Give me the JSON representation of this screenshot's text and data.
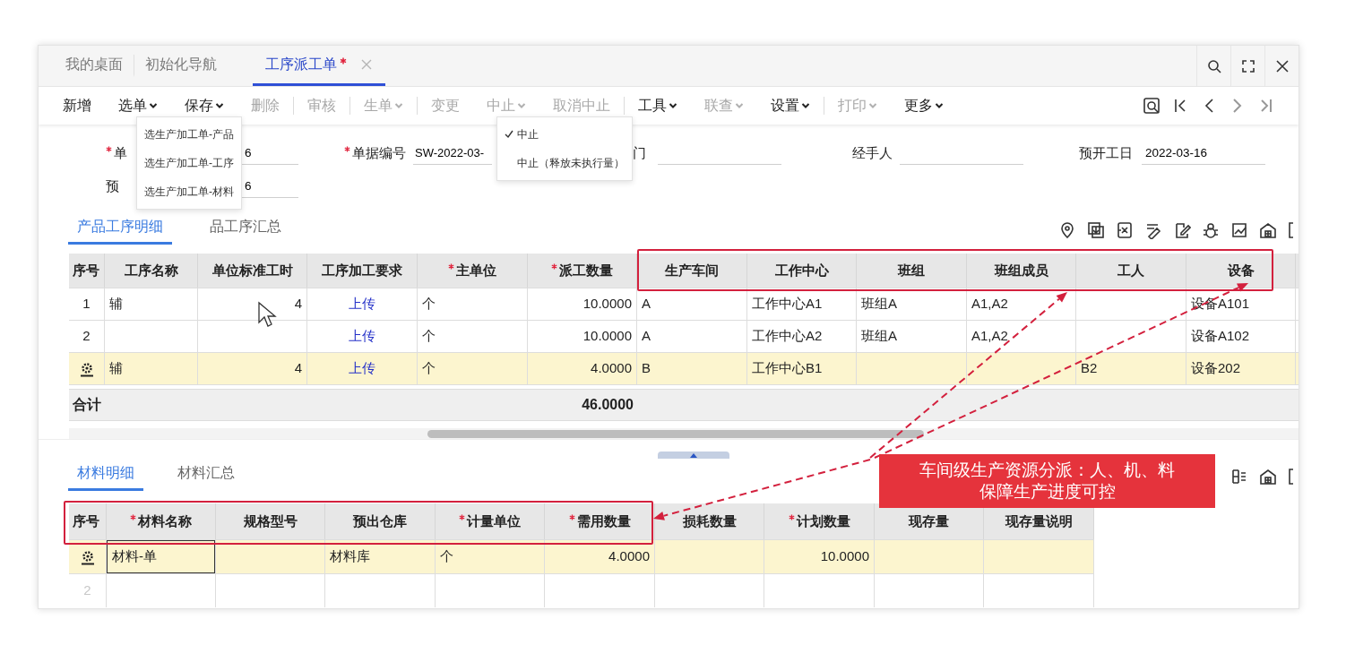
{
  "tabs": [
    {
      "label": "我的桌面",
      "selected": false,
      "modified": false,
      "closable": false
    },
    {
      "label": "初始化导航",
      "selected": false,
      "modified": false,
      "closable": false
    },
    {
      "label": "工序派工单",
      "selected": true,
      "modified": true,
      "closable": true
    }
  ],
  "toolbar": {
    "items": [
      {
        "label": "新增",
        "disabled": false,
        "dropdown": false,
        "separator_before": false
      },
      {
        "label": "选单",
        "disabled": false,
        "dropdown": true,
        "separator_before": false,
        "menu": {
          "items": [
            {
              "label": "选生产加工单-产品",
              "checked": false
            },
            {
              "label": "选生产加工单-工序",
              "checked": false
            },
            {
              "label": "选生产加工单-材料",
              "checked": false
            }
          ]
        }
      },
      {
        "label": "保存",
        "disabled": false,
        "dropdown": true,
        "separator_before": false
      },
      {
        "label": "删除",
        "disabled": true,
        "dropdown": false,
        "separator_before": false
      },
      {
        "label": "审核",
        "disabled": true,
        "dropdown": false,
        "separator_before": true
      },
      {
        "label": "生单",
        "disabled": true,
        "dropdown": true,
        "separator_before": true
      },
      {
        "label": "变更",
        "disabled": true,
        "dropdown": false,
        "separator_before": true
      },
      {
        "label": "中止",
        "disabled": true,
        "dropdown": true,
        "separator_before": false,
        "menu": {
          "items": [
            {
              "label": "中止",
              "checked": true
            },
            {
              "label": "中止（释放未执行量）",
              "checked": false
            }
          ]
        }
      },
      {
        "label": "取消中止",
        "disabled": true,
        "dropdown": false,
        "separator_before": false
      },
      {
        "label": "工具",
        "disabled": false,
        "dropdown": true,
        "separator_before": true
      },
      {
        "label": "联查",
        "disabled": true,
        "dropdown": true,
        "separator_before": false
      },
      {
        "label": "设置",
        "disabled": false,
        "dropdown": true,
        "separator_before": false
      },
      {
        "label": "打印",
        "disabled": true,
        "dropdown": true,
        "separator_before": true
      },
      {
        "label": "更多",
        "disabled": false,
        "dropdown": true,
        "separator_before": false
      }
    ]
  },
  "form": {
    "rows": [
      [
        {
          "label": "单",
          "required": true,
          "value": "6"
        },
        {
          "label": "单据编号",
          "required": true,
          "value": "SW-2022-03-"
        },
        {
          "label": "门",
          "required": false
        },
        {
          "label": "经手人",
          "required": false
        },
        {
          "label": "预开工日",
          "required": false,
          "value": "2022-03-16"
        }
      ],
      [
        {
          "label": "预",
          "required": false,
          "value": "6"
        }
      ]
    ]
  },
  "detail_tabs": [
    {
      "label": "产品工序明细",
      "selected": true
    },
    {
      "label": "品工序汇总",
      "selected": false
    }
  ],
  "process_table": {
    "columns": [
      {
        "label": "序号",
        "required": false,
        "kind": "seq"
      },
      {
        "label": "工序名称",
        "required": false,
        "kind": "text"
      },
      {
        "label": "单位标准工时",
        "required": false,
        "kind": "number"
      },
      {
        "label": "工序加工要求",
        "required": false,
        "kind": "link"
      },
      {
        "label": "主单位",
        "required": true,
        "kind": "text"
      },
      {
        "label": "派工数量",
        "required": true,
        "kind": "number",
        "total": "46.0000"
      },
      {
        "label": "生产车间",
        "required": false,
        "kind": "text"
      },
      {
        "label": "工作中心",
        "required": false,
        "kind": "text"
      },
      {
        "label": "班组",
        "required": false,
        "kind": "text"
      },
      {
        "label": "班组成员",
        "required": false,
        "kind": "text"
      },
      {
        "label": "工人",
        "required": false,
        "kind": "text"
      },
      {
        "label": "设备",
        "required": false,
        "kind": "text"
      }
    ],
    "rows": [
      {
        "selected": false,
        "cells": [
          "1",
          "辅",
          "4",
          "上传",
          "个",
          "10.0000",
          "A",
          "工作中心A1",
          "班组A",
          "A1,A2",
          null,
          "设备A101"
        ]
      },
      {
        "selected": false,
        "cells": [
          "2",
          null,
          null,
          "上传",
          "个",
          "10.0000",
          "A",
          "工作中心A2",
          "班组A",
          "A1,A2",
          null,
          "设备A102"
        ]
      },
      {
        "selected": true,
        "cells": [
          null,
          "辅",
          "4",
          "上传",
          "个",
          "4.0000",
          "B",
          "工作中心B1",
          null,
          null,
          "B2",
          "设备202"
        ]
      }
    ],
    "total_label": "合计"
  },
  "material_tabs": [
    {
      "label": "材料明细",
      "selected": true
    },
    {
      "label": "材料汇总",
      "selected": false
    }
  ],
  "material_table": {
    "columns": [
      {
        "label": "序号",
        "required": false,
        "kind": "seq"
      },
      {
        "label": "材料名称",
        "required": true,
        "kind": "text"
      },
      {
        "label": "规格型号",
        "required": false,
        "kind": "text"
      },
      {
        "label": "预出仓库",
        "required": false,
        "kind": "text"
      },
      {
        "label": "计量单位",
        "required": true,
        "kind": "text"
      },
      {
        "label": "需用数量",
        "required": true,
        "kind": "number"
      },
      {
        "label": "损耗数量",
        "required": false,
        "kind": "number"
      },
      {
        "label": "计划数量",
        "required": true,
        "kind": "number"
      },
      {
        "label": "现存量",
        "required": false,
        "kind": "number"
      },
      {
        "label": "现存量说明",
        "required": false,
        "kind": "text"
      }
    ],
    "rows": [
      {
        "selected": true,
        "empty": false,
        "cells": [
          null,
          {
            "text": "材料-单",
            "focused": true
          },
          null,
          "材料库",
          "个",
          "4.0000",
          null,
          "10.0000",
          null,
          null
        ]
      },
      {
        "selected": false,
        "empty": true,
        "cells": [
          "2",
          null,
          null,
          null,
          null,
          null,
          null,
          null,
          null,
          null
        ]
      }
    ]
  },
  "callout": {
    "lines": [
      "车间级生产资源分派：人、机、料",
      "保障生产进度可控"
    ]
  }
}
